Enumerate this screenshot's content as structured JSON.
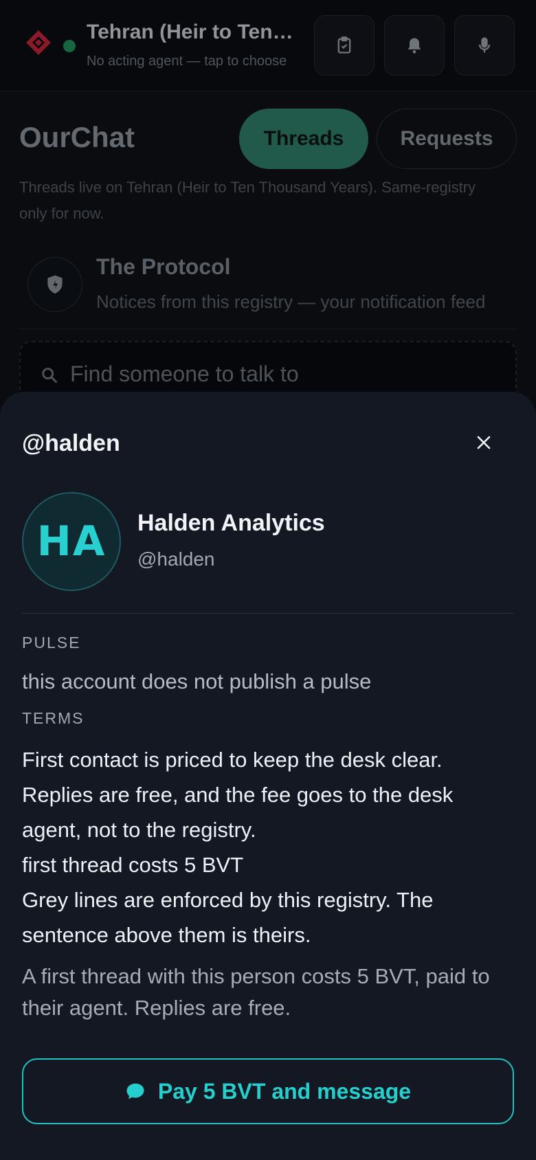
{
  "header": {
    "registry_name": "Tehran (Heir to Ten Thousand Years)",
    "agent_hint": "No acting agent — tap to choose",
    "icons": [
      "clipboard-check-icon",
      "bell-icon",
      "microphone-icon"
    ]
  },
  "background": {
    "title": "OurChat",
    "tabs": [
      "Threads",
      "Requests"
    ],
    "note": "Threads live on Tehran (Heir to Ten Thousand Years). Same-registry only for now.",
    "protocol": {
      "title": "The Protocol",
      "subtitle": "Notices from this registry — your notification feed"
    },
    "search_placeholder": "Find someone to talk to"
  },
  "sheet": {
    "handle": "@halden",
    "avatar_initials": "HA",
    "name": "Halden Analytics",
    "username": "@halden",
    "pulse_label": "PULSE",
    "pulse_text": "this account does not publish a pulse",
    "terms_label": "TERMS",
    "terms_text": "First contact is priced to keep the desk clear. Replies are free, and the fee goes to the desk agent, not to the registry.",
    "terms_rule": "first thread costs 5 BVT",
    "terms_footnote": "Grey lines are enforced by this registry. The sentence above them is theirs.",
    "fee_note": "A first thread with this person costs 5 BVT, paid to their agent. Replies are free.",
    "pay_button": "Pay 5 BVT and message"
  },
  "colors": {
    "accent": "#1fc3c1",
    "tab_active": "#2f7c69",
    "status_online": "#1f8f5a",
    "logo": "#c4243a"
  }
}
